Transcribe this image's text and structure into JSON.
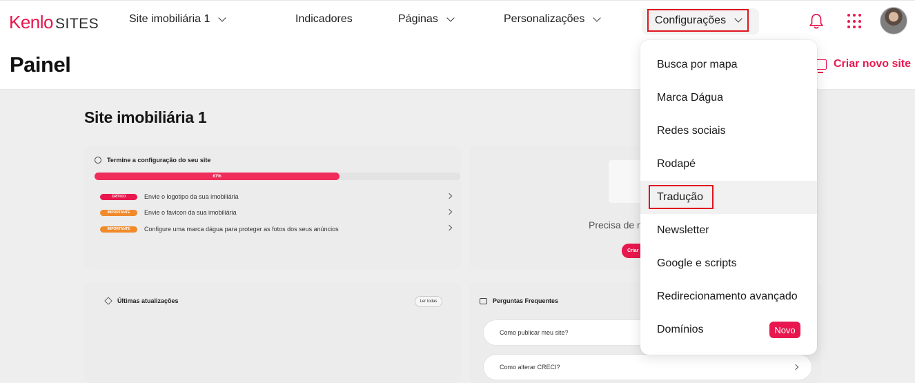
{
  "brand": {
    "logo_main": "Kenlo",
    "logo_sub": "SITES",
    "accent": "#e8174d"
  },
  "nav": {
    "site_selector": "Site imobiliária 1",
    "indicators": "Indicadores",
    "pages": "Páginas",
    "customizations": "Personalizações",
    "settings": "Configurações"
  },
  "header": {
    "title": "Painel",
    "create_site": "Criar novo site"
  },
  "main": {
    "site_title": "Site imobiliária 1",
    "setup": {
      "heading": "Termine a configuração do seu site",
      "progress_label": "67%",
      "progress": 0.67,
      "tasks": [
        {
          "badge": "Crítico",
          "text": "Envie o logotipo da sua imobiliária"
        },
        {
          "badge": "Importante",
          "text": "Envie o favicon da sua imobiliária"
        },
        {
          "badge": "Importante",
          "text": "Configure uma marca dágua para proteger as fotos dos seus anúncios"
        }
      ]
    },
    "preview": {
      "text": "Precisa de n",
      "button": "Criar"
    },
    "updates": {
      "heading": "Últimas atualizações",
      "read_all": "Ler todas"
    },
    "faq": {
      "heading": "Perguntas Frequentes",
      "items": [
        "Como publicar meu site?",
        "Como alterar CRECI?"
      ]
    }
  },
  "dropdown": {
    "items": [
      "Busca por mapa",
      "Marca Dágua",
      "Redes sociais",
      "Rodapé",
      "Tradução",
      "Newsletter",
      "Google e scripts",
      "Redirecionamento avançado",
      "Domínios"
    ],
    "new_badge": "Novo"
  }
}
